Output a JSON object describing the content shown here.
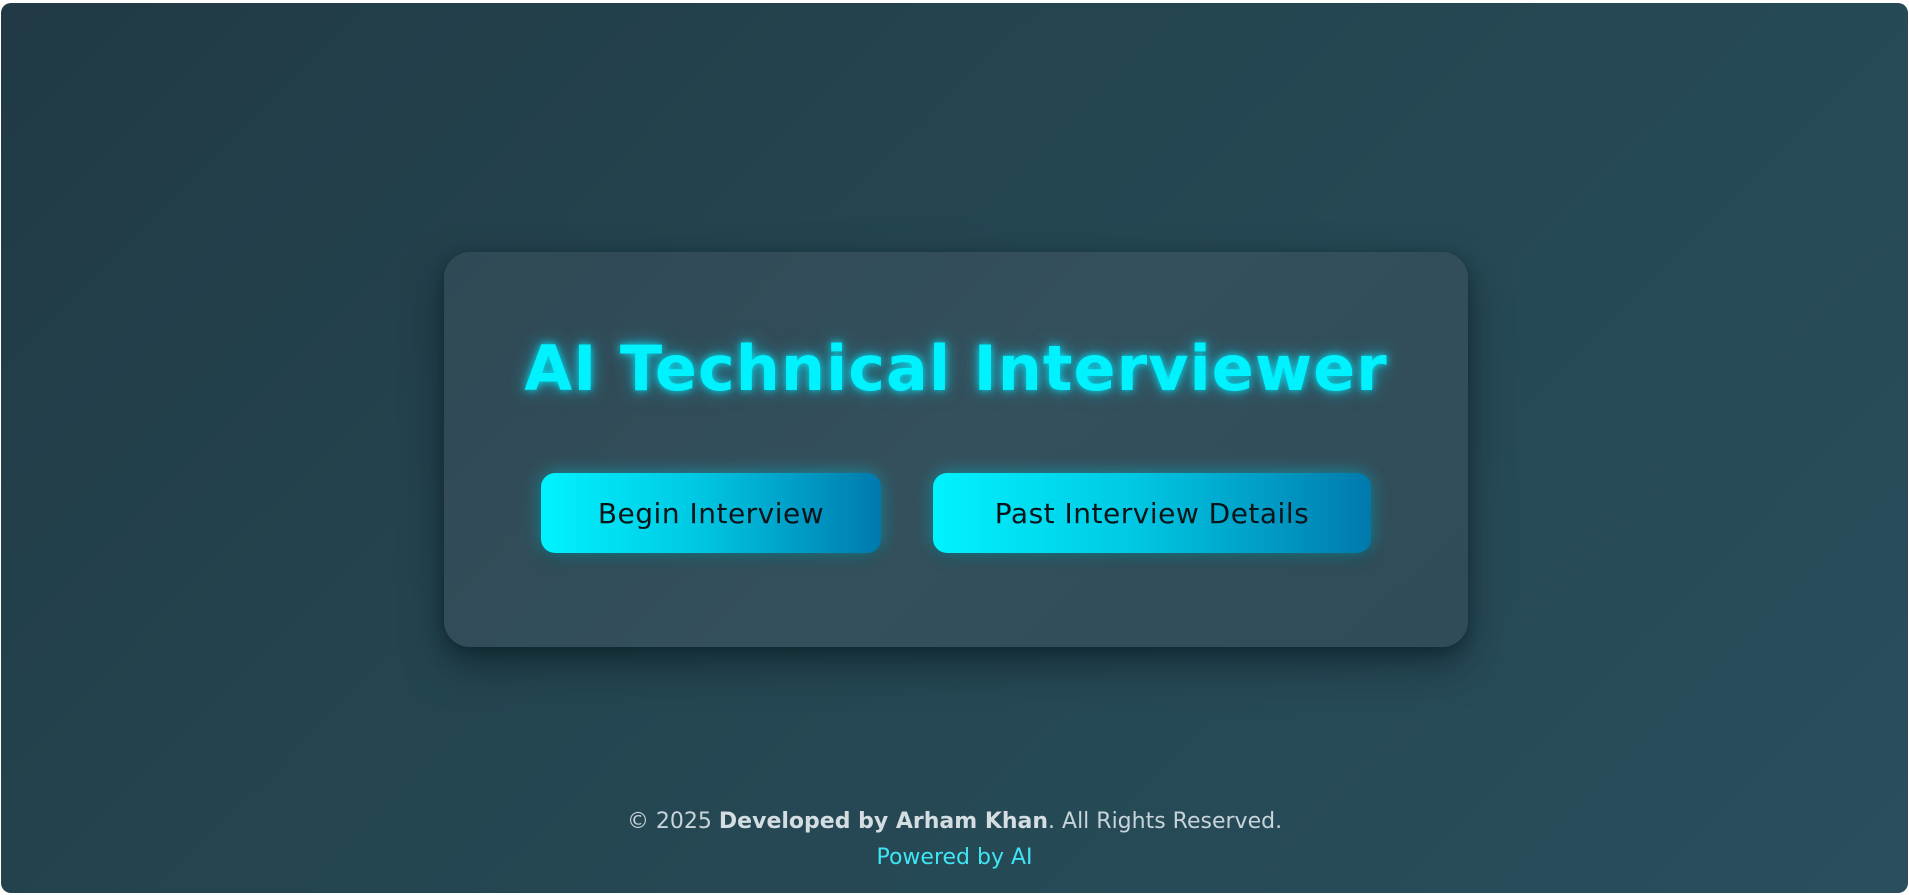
{
  "app": {
    "title": "AI Technical Interviewer"
  },
  "actions": {
    "begin_label": "Begin Interview",
    "past_label": "Past Interview Details"
  },
  "footer": {
    "copyright_prefix": "© 2025 ",
    "developer": "Developed by Arham Khan",
    "rights": ". All Rights Reserved.",
    "powered_by": "Powered by AI"
  },
  "colors": {
    "accent": "#00f2ff",
    "background": "#244651",
    "card": "#34505c",
    "button_gradient_start": "#00f3ff",
    "button_gradient_end": "#0079ad"
  }
}
